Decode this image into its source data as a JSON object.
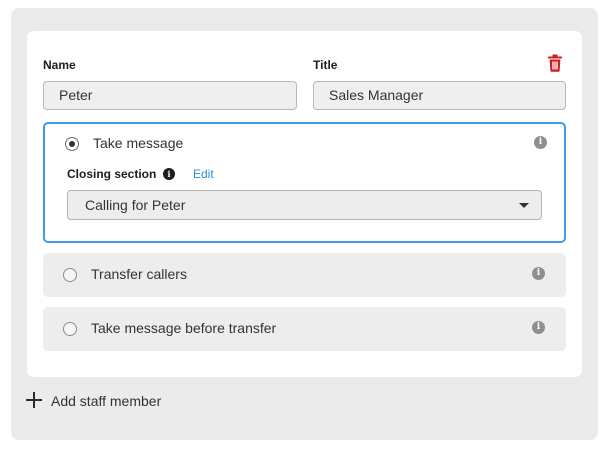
{
  "staff_member": {
    "name_label": "Name",
    "name_value": "Peter",
    "title_label": "Title",
    "title_value": "Sales Manager",
    "delete_icon": "trash-icon",
    "delete_color": "#cc1f1f"
  },
  "options": [
    {
      "label": "Take message",
      "selected": true,
      "info_icon": "info-icon"
    },
    {
      "label": "Transfer callers",
      "selected": false,
      "info_icon": "info-icon"
    },
    {
      "label": "Take message before transfer",
      "selected": false,
      "info_icon": "info-icon"
    }
  ],
  "closing": {
    "label": "Closing section",
    "edit_label": "Edit",
    "selected_value": "Calling for Peter"
  },
  "add_staff": {
    "label": "Add staff member",
    "icon": "plus-icon"
  },
  "colors": {
    "accent": "#3d9be9",
    "link": "#2a8fd6",
    "delete": "#cc1f1f"
  }
}
